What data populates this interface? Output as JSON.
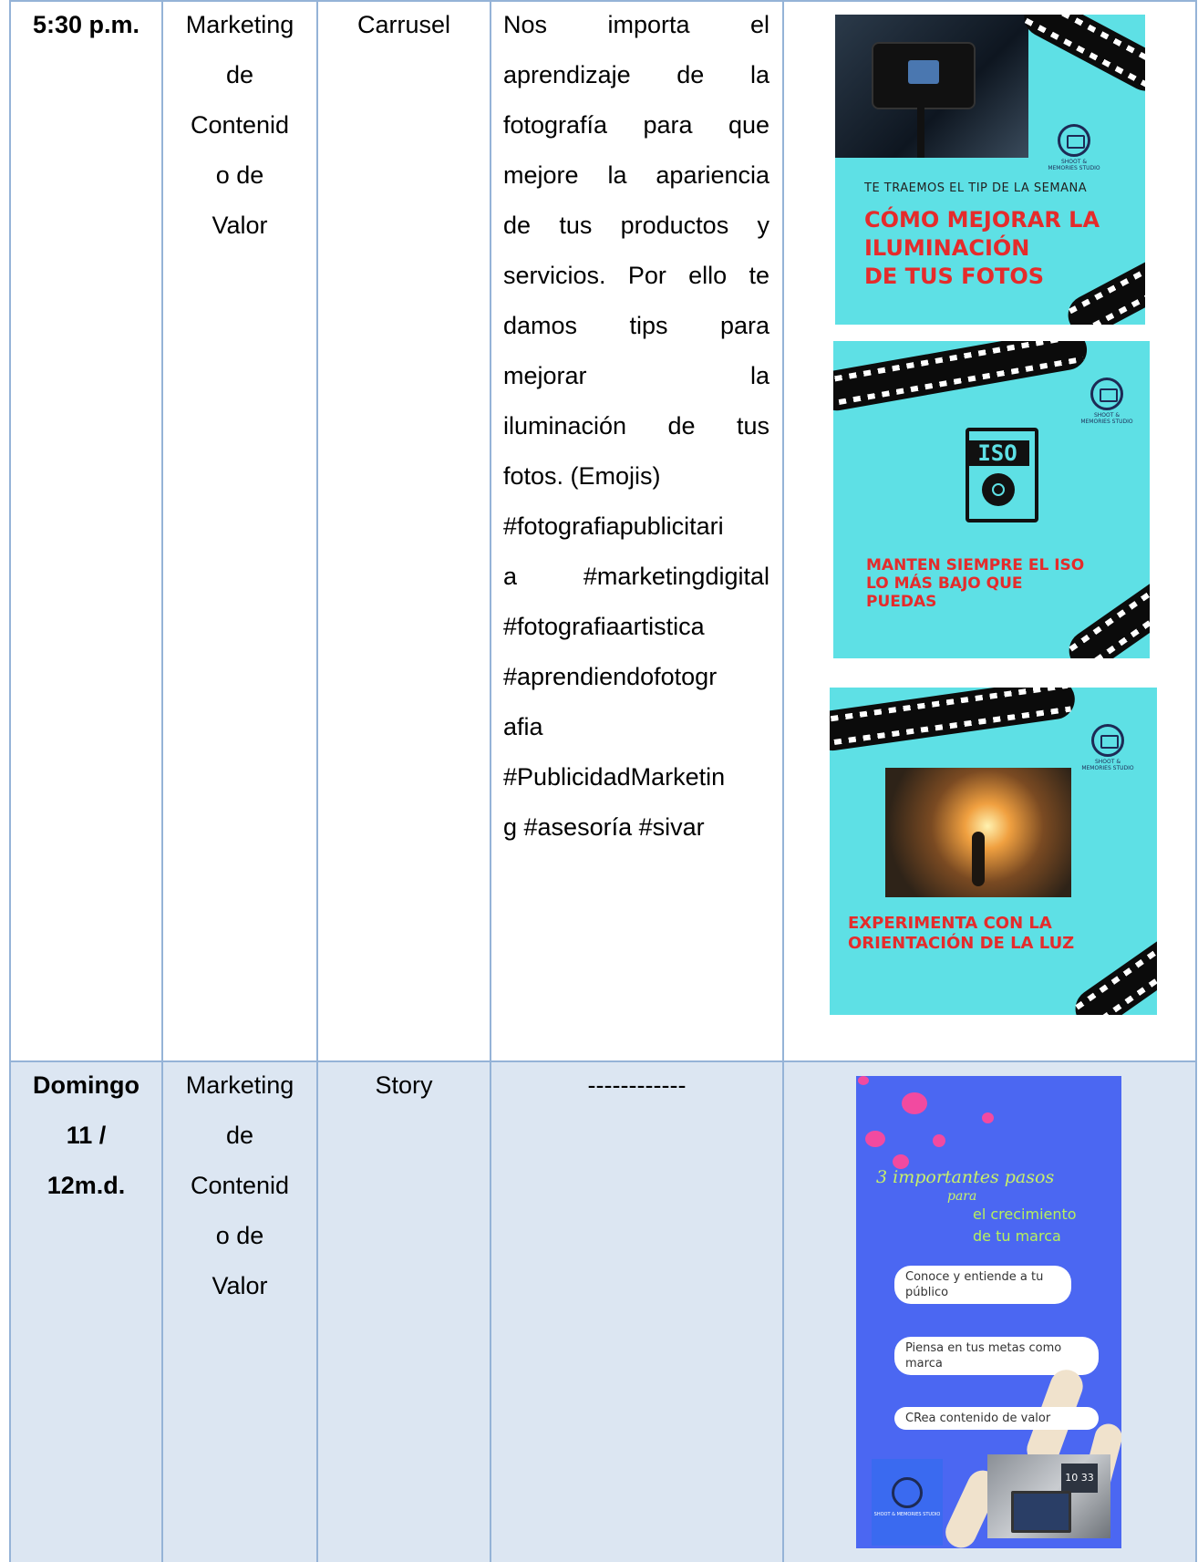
{
  "rows": [
    {
      "time_lines": [
        "5:30 p.m."
      ],
      "category_lines": [
        "Marketing",
        "de",
        "Contenid",
        "o de",
        "Valor"
      ],
      "format": "Carrusel",
      "copy_lines": [
        "Nos importa el",
        "aprendizaje de la",
        "fotografía para que",
        "mejore la apariencia",
        "de tus productos y",
        "servicios. Por ello te",
        "damos tips para",
        "mejorar la",
        "iluminación de tus",
        "fotos. (Emojis)",
        "#fotografiapublicitari",
        "a #marketingdigital",
        "#fotografiaartistica",
        "#aprendiendofotogr",
        "afia",
        "#PublicidadMarketin",
        "g #asesoría #sivar"
      ],
      "slides": [
        {
          "kicker": "TE TRAEMOS EL TIP DE LA SEMANA",
          "headline_lines": [
            "CÓMO MEJORAR LA",
            "ILUMINACIÓN",
            "DE TUS FOTOS"
          ],
          "logo_text": "SHOOT & MEMORIES STUDIO"
        },
        {
          "icon_label": "ISO",
          "headline_lines": [
            "MANTEN SIEMPRE EL ISO",
            "LO MÁS BAJO QUE",
            "PUEDAS"
          ],
          "logo_text": "SHOOT & MEMORIES STUDIO"
        },
        {
          "headline_lines": [
            "EXPERIMENTA CON LA",
            "ORIENTACIÓN DE LA LUZ"
          ],
          "logo_text": "SHOOT & MEMORIES STUDIO"
        }
      ]
    },
    {
      "time_lines": [
        "Domingo",
        "11 /",
        "12m.d."
      ],
      "category_lines": [
        "Marketing",
        "de",
        "Contenid",
        "o de",
        "Valor"
      ],
      "format": "Story",
      "copy_placeholder": "------------",
      "story": {
        "title": "3 importantes pasos",
        "sub1": "para",
        "sub2": "el crecimiento",
        "sub3": "de tu marca",
        "steps": [
          "Conoce y entiende a tu público",
          "Piensa en tus metas como marca",
          "CRea contenido de valor"
        ],
        "logo_text": "SHOOT & MEMORIES STUDIO",
        "clock": "10 33"
      }
    }
  ],
  "colors": {
    "border": "#95b3d7",
    "row2_bg": "#dce6f2",
    "promo_bg": "#5ee0e5",
    "promo_red": "#e52b2b",
    "story_bg": "#4b67f2"
  }
}
